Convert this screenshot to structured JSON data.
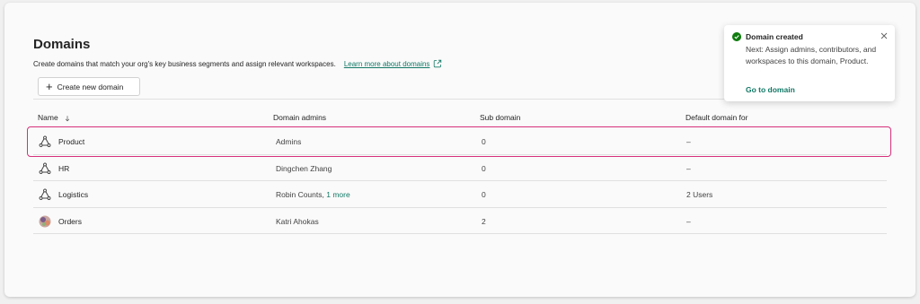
{
  "page": {
    "title": "Domains",
    "subtitle": "Create domains that match your org's key business segments and assign relevant workspaces.",
    "learn_more": "Learn more about domains",
    "create_button": "Create new domain"
  },
  "table": {
    "columns": {
      "name": "Name",
      "admins": "Domain admins",
      "sub": "Sub domain",
      "default_for": "Default domain for"
    },
    "rows": [
      {
        "name": "Product",
        "admins": "Admins",
        "admins_more": "",
        "sub": "0",
        "default_for": "–",
        "icon": "domain-icon"
      },
      {
        "name": "HR",
        "admins": "Dingchen Zhang",
        "admins_more": "",
        "sub": "0",
        "default_for": "–",
        "icon": "domain-icon"
      },
      {
        "name": "Logistics",
        "admins": "Robin Counts,",
        "admins_more": "1 more",
        "sub": "0",
        "default_for": "2 Users",
        "icon": "domain-icon"
      },
      {
        "name": "Orders",
        "admins": "Katri Ahokas",
        "admins_more": "",
        "sub": "2",
        "default_for": "–",
        "icon": "domain-image-icon"
      }
    ]
  },
  "toast": {
    "title": "Domain created",
    "body": "Next: Assign admins, contributors, and workspaces to this domain, Product.",
    "link": "Go to domain"
  },
  "colors": {
    "accent": "#117865",
    "success": "#107c10",
    "selection": "#d7307b"
  }
}
